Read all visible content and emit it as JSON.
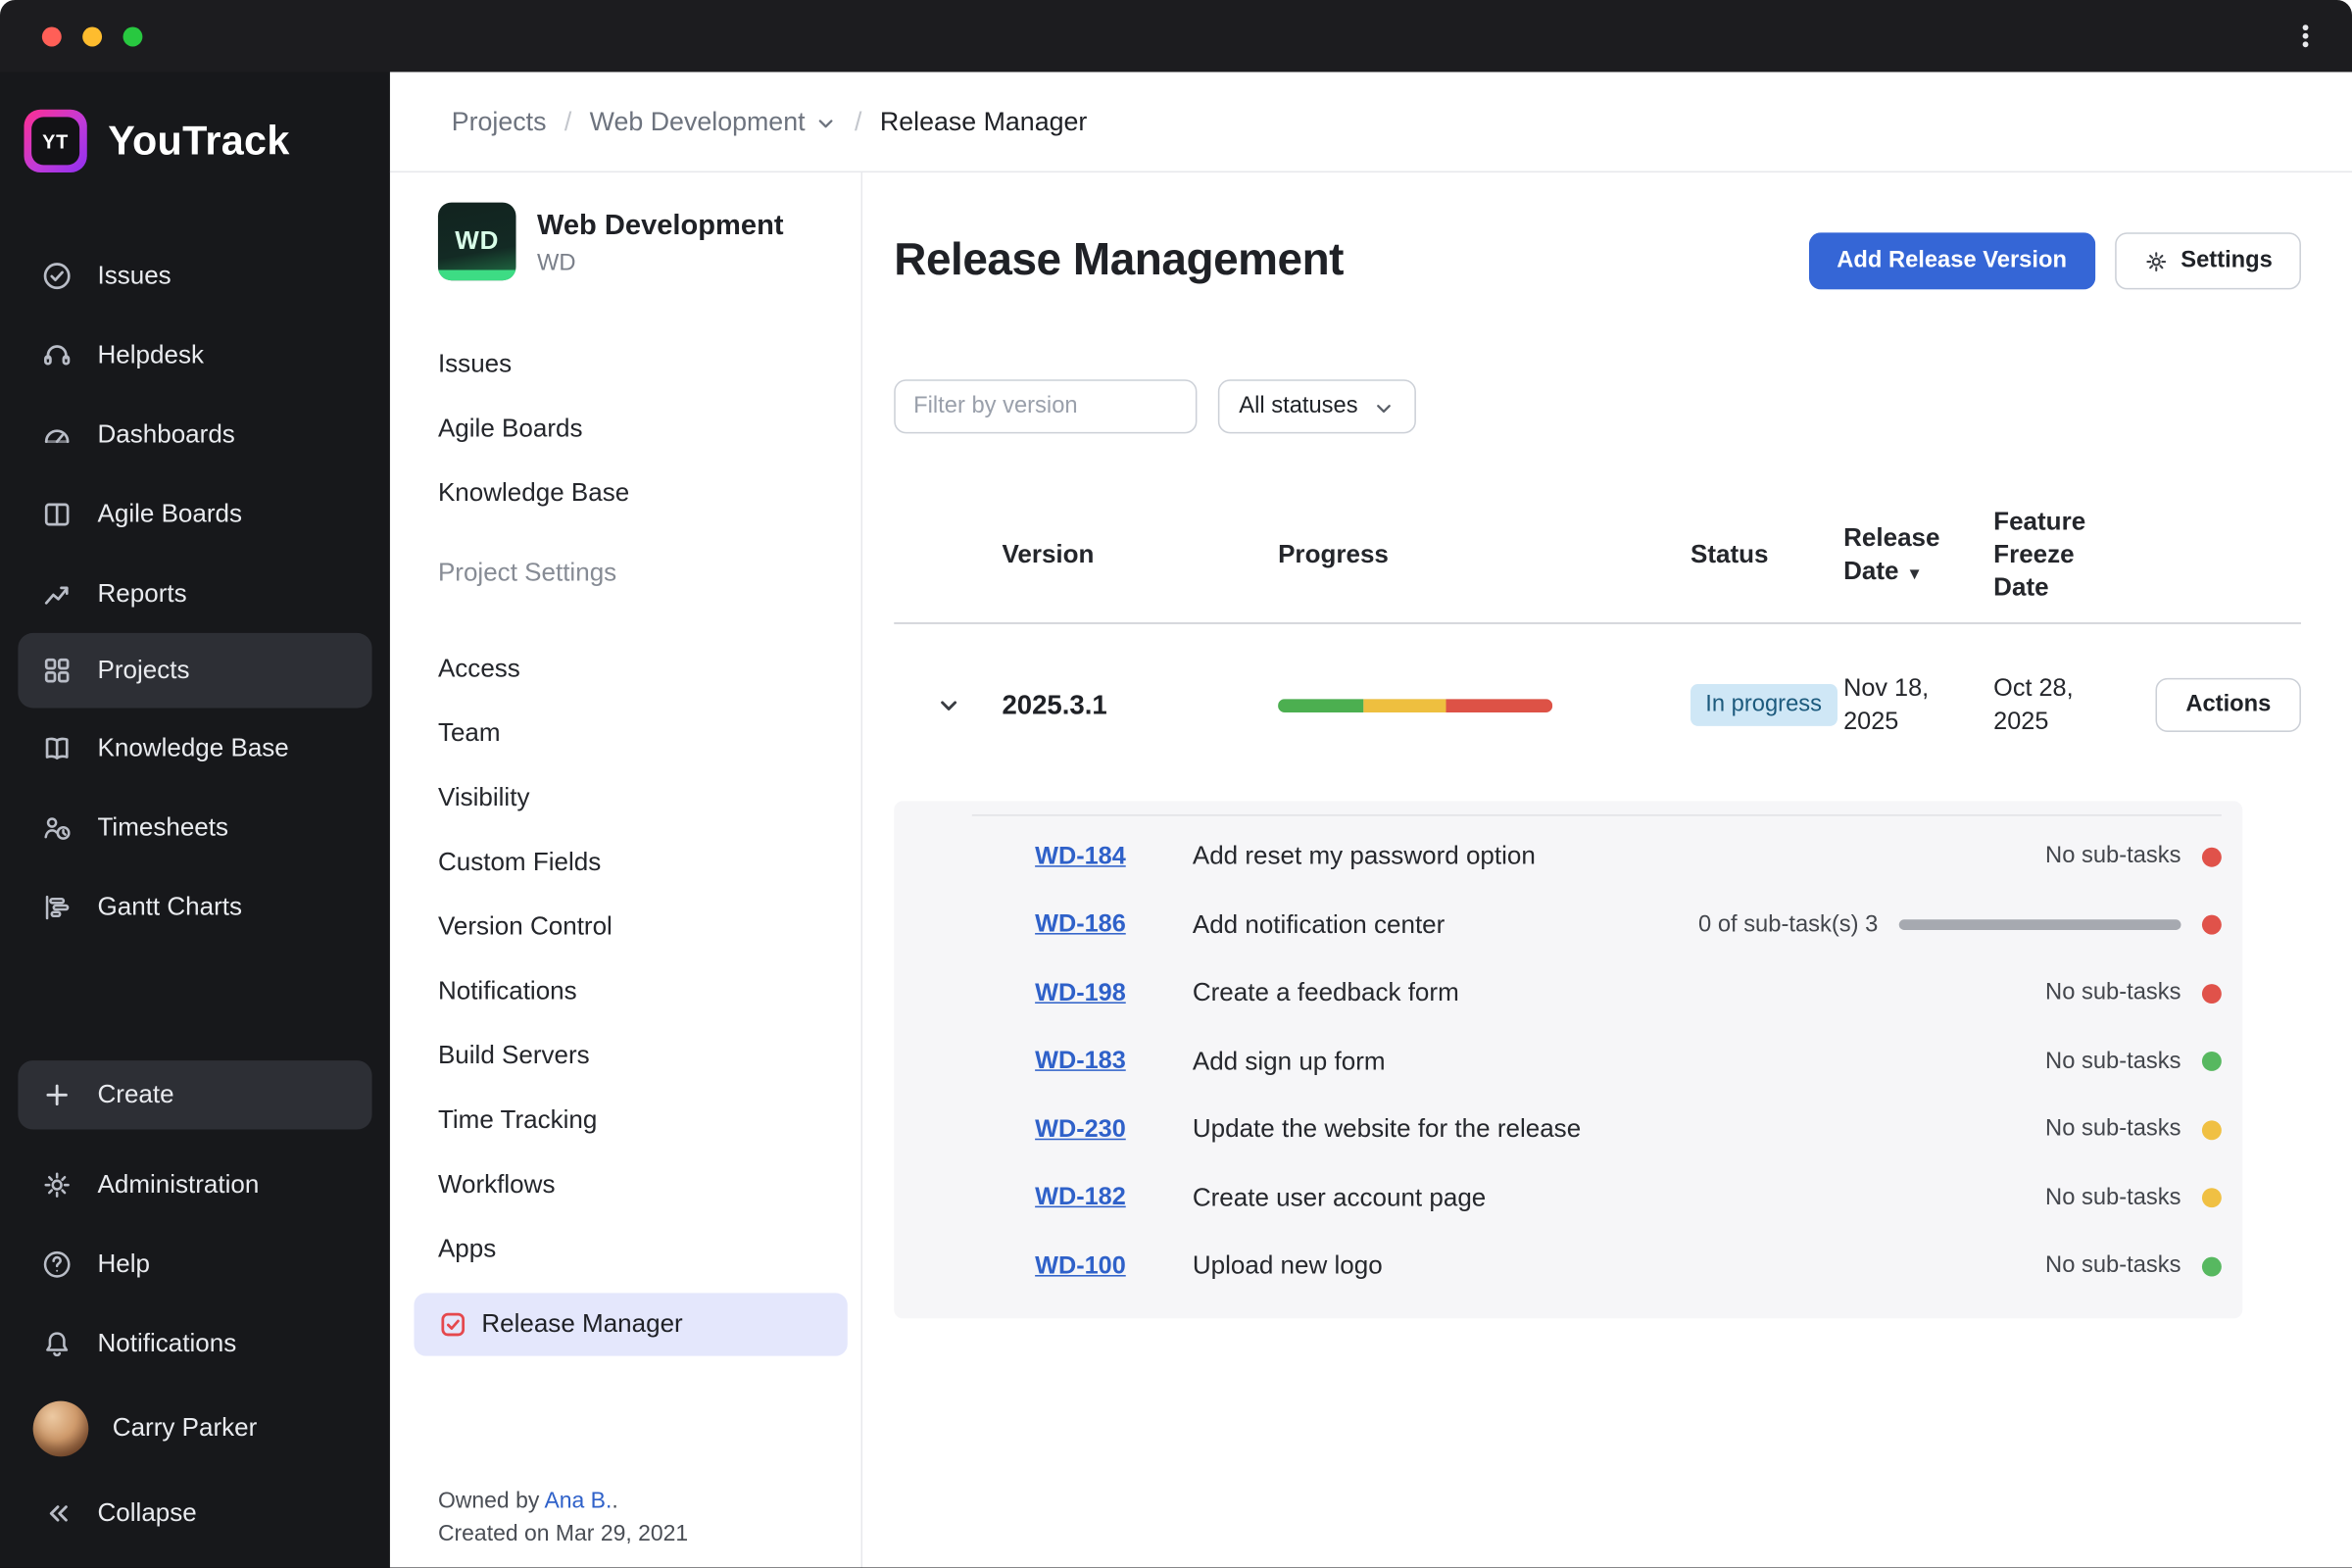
{
  "colors": {
    "titlebar-bg": "#1c1c1f",
    "sidebar-bg": "#17181b",
    "sidebar-active-bg": "#2d2f35",
    "panel-active-bg": "#e4e7fc",
    "accent-blue": "#3566d6",
    "link-blue": "#2f61c9",
    "badge-bg": "#cfe7f6",
    "badge-text": "#1c5a7d",
    "progress-green": "#4caf50",
    "progress-yellow": "#eebf3f",
    "progress-red": "#dd5246",
    "dot-red": "#e0524a",
    "dot-green": "#57b860",
    "dot-yellow": "#f0c043",
    "release-manager-icon": "#e5484d",
    "wd-avatar-green": "#3ddc84",
    "traffic-red": "#ff5f57",
    "traffic-yellow": "#febc2e",
    "traffic-green": "#28c840"
  },
  "sidebar": {
    "logo_badge": "YT",
    "logo_text": "YouTrack",
    "items": [
      {
        "label": "Issues",
        "icon": "issues-icon"
      },
      {
        "label": "Helpdesk",
        "icon": "helpdesk-icon"
      },
      {
        "label": "Dashboards",
        "icon": "dashboards-icon"
      },
      {
        "label": "Agile Boards",
        "icon": "agile-boards-icon"
      },
      {
        "label": "Reports",
        "icon": "reports-icon"
      },
      {
        "label": "Projects",
        "icon": "projects-icon",
        "active": true
      },
      {
        "label": "Knowledge Base",
        "icon": "knowledge-base-icon"
      },
      {
        "label": "Timesheets",
        "icon": "timesheets-icon"
      },
      {
        "label": "Gantt Charts",
        "icon": "gantt-charts-icon"
      }
    ],
    "create_label": "Create",
    "bottom_items": [
      {
        "label": "Administration",
        "icon": "gear-icon"
      },
      {
        "label": "Help",
        "icon": "help-icon"
      },
      {
        "label": "Notifications",
        "icon": "bell-icon"
      }
    ],
    "user_name": "Carry Parker",
    "collapse_label": "Collapse"
  },
  "breadcrumb": {
    "items": [
      "Projects",
      "Web Development",
      "Release Manager"
    ]
  },
  "project_panel": {
    "avatar_text": "WD",
    "title": "Web Development",
    "key": "WD",
    "nav_items": [
      "Issues",
      "Agile Boards",
      "Knowledge Base"
    ],
    "section_title": "Project Settings",
    "settings_items": [
      "Access",
      "Team",
      "Visibility",
      "Custom Fields",
      "Version Control",
      "Notifications",
      "Build Servers",
      "Time Tracking",
      "Workflows",
      "Apps"
    ],
    "active_item": "Release Manager",
    "owned_by_prefix": "Owned by",
    "owner_name": "Ana B.",
    "owner_suffix": ".",
    "created_text": "Created on Mar 29, 2021"
  },
  "main": {
    "title": "Release Management",
    "add_button": "Add Release Version",
    "settings_button": "Settings",
    "filter_placeholder": "Filter by version",
    "status_filter": "All statuses",
    "table": {
      "columns": [
        "Version",
        "Progress",
        "Status",
        "Release Date",
        "Feature Freeze Date"
      ],
      "release": {
        "version": "2025.3.1",
        "progress": {
          "green": 31,
          "yellow": 30,
          "red": 39
        },
        "status": "In progress",
        "release_date": "Nov 18, 2025",
        "freeze_date": "Oct 28, 2025",
        "actions_label": "Actions"
      },
      "issues": [
        {
          "id": "WD-184",
          "summary": "Add reset my password option",
          "subtasks": "No sub-tasks",
          "dot": "red"
        },
        {
          "id": "WD-186",
          "summary": "Add notification center",
          "subtasks": "0 of sub-task(s) 3",
          "dot": "red"
        },
        {
          "id": "WD-198",
          "summary": "Create a feedback form",
          "subtasks": "No sub-tasks",
          "dot": "red"
        },
        {
          "id": "WD-183",
          "summary": "Add sign up form",
          "subtasks": "No sub-tasks",
          "dot": "green"
        },
        {
          "id": "WD-230",
          "summary": "Update the website for the release",
          "subtasks": "No sub-tasks",
          "dot": "yellow"
        },
        {
          "id": "WD-182",
          "summary": "Create user account page",
          "subtasks": "No sub-tasks",
          "dot": "yellow"
        },
        {
          "id": "WD-100",
          "summary": "Upload new logo",
          "subtasks": "No sub-tasks",
          "dot": "green"
        }
      ]
    }
  }
}
